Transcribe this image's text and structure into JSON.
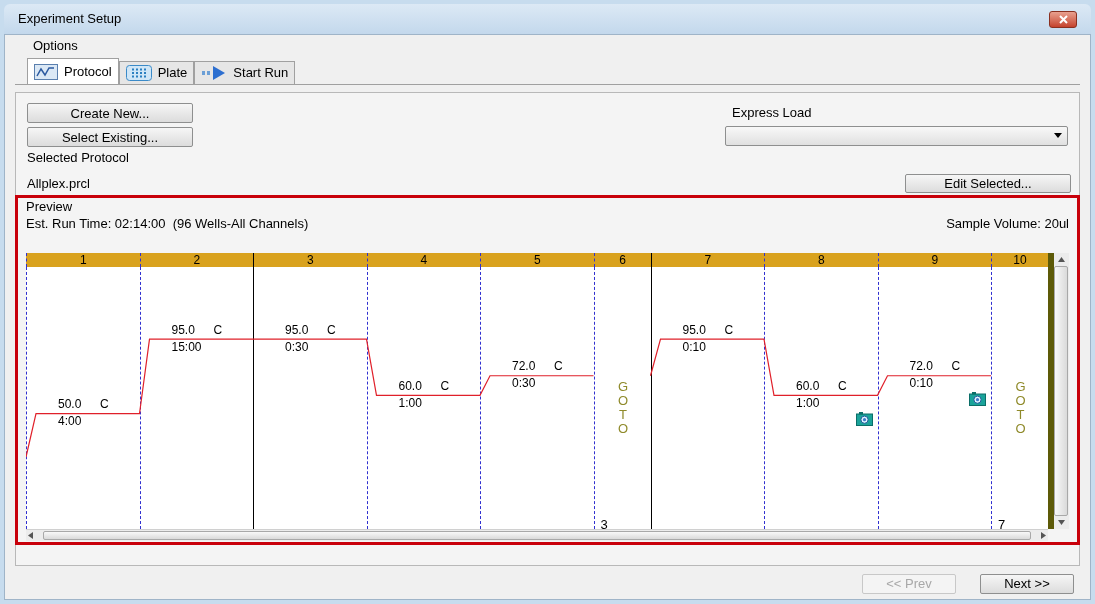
{
  "window": {
    "title": "Experiment Setup"
  },
  "menu": [
    "Options"
  ],
  "tabs": [
    {
      "label": "Protocol",
      "selected": true
    },
    {
      "label": "Plate",
      "selected": false
    },
    {
      "label": "Start Run",
      "selected": false
    }
  ],
  "protocol_buttons": [
    "Create New...",
    "Select Existing..."
  ],
  "express_load": {
    "label": "Express Load"
  },
  "selected_protocol": {
    "label": "Selected Protocol",
    "value": "Allplex.prcl",
    "button": "Edit Selected..."
  },
  "preview": {
    "label": "Preview",
    "run_time": "Est. Run Time: 02:14:00  (96 Wells-All Channels)",
    "sample_volume": "Sample Volume: 20ul",
    "steps": [
      {
        "number": "1",
        "kind": "hold",
        "cycle_start": false,
        "temp": "50.0",
        "unit": "C",
        "time": "4:00",
        "camera": false
      },
      {
        "number": "2",
        "kind": "hold",
        "cycle_start": false,
        "temp": "95.0",
        "unit": "C",
        "time": "15:00",
        "camera": false
      },
      {
        "number": "3",
        "kind": "hold",
        "cycle_start": true,
        "temp": "95.0",
        "unit": "C",
        "time": "0:30",
        "camera": false
      },
      {
        "number": "4",
        "kind": "hold",
        "cycle_start": false,
        "temp": "60.0",
        "unit": "C",
        "time": "1:00",
        "camera": false
      },
      {
        "number": "5",
        "kind": "hold",
        "cycle_start": false,
        "temp": "72.0",
        "unit": "C",
        "time": "0:30",
        "camera": false
      },
      {
        "number": "6",
        "kind": "goto",
        "cycle_start": false,
        "text": "GOTO",
        "target": "3"
      },
      {
        "number": "7",
        "kind": "hold",
        "cycle_start": true,
        "temp": "95.0",
        "unit": "C",
        "time": "0:10",
        "camera": false
      },
      {
        "number": "8",
        "kind": "hold",
        "cycle_start": false,
        "temp": "60.0",
        "unit": "C",
        "time": "1:00",
        "camera": true
      },
      {
        "number": "9",
        "kind": "hold",
        "cycle_start": false,
        "temp": "72.0",
        "unit": "C",
        "time": "0:10",
        "camera": true
      },
      {
        "number": "10",
        "kind": "goto",
        "cycle_start": false,
        "text": "GOTO",
        "target": "7"
      }
    ]
  },
  "nav": [
    {
      "label": "<< Prev",
      "disabled": true
    },
    {
      "label": "Next >>",
      "disabled": false
    }
  ]
}
